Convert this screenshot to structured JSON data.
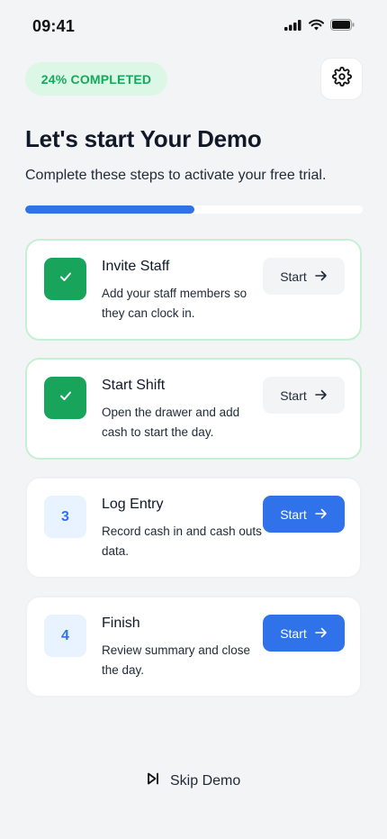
{
  "status_bar": {
    "time": "09:41"
  },
  "header": {
    "progress_label": "24% COMPLETED",
    "progress_fraction": 0.5
  },
  "title": "Let's start Your Demo",
  "subtitle": "Complete these steps to activate your free trial.",
  "steps": [
    {
      "number": "",
      "title": "Invite Staff",
      "description": "Add your staff members so they can clock in.",
      "button": "Start",
      "state": "completed"
    },
    {
      "number": "",
      "title": "Start Shift",
      "description": "Open the drawer and add cash to start the day.",
      "button": "Start",
      "state": "completed"
    },
    {
      "number": "3",
      "title": "Log Entry",
      "description": "Record cash in and cash outs data.",
      "button": "Start",
      "state": "pending"
    },
    {
      "number": "4",
      "title": "Finish",
      "description": "Review summary and close the day.",
      "button": "Start",
      "state": "pending"
    }
  ],
  "footer": {
    "skip_label": "Skip Demo"
  },
  "icons": {
    "settings": "gear-icon",
    "check": "check-icon",
    "arrow": "arrow-right-icon",
    "skip": "skip-forward-icon"
  },
  "colors": {
    "accent": "#2f72ea",
    "success": "#18a45a",
    "success_light": "#dcf7e5",
    "background": "#f3f4f6"
  }
}
